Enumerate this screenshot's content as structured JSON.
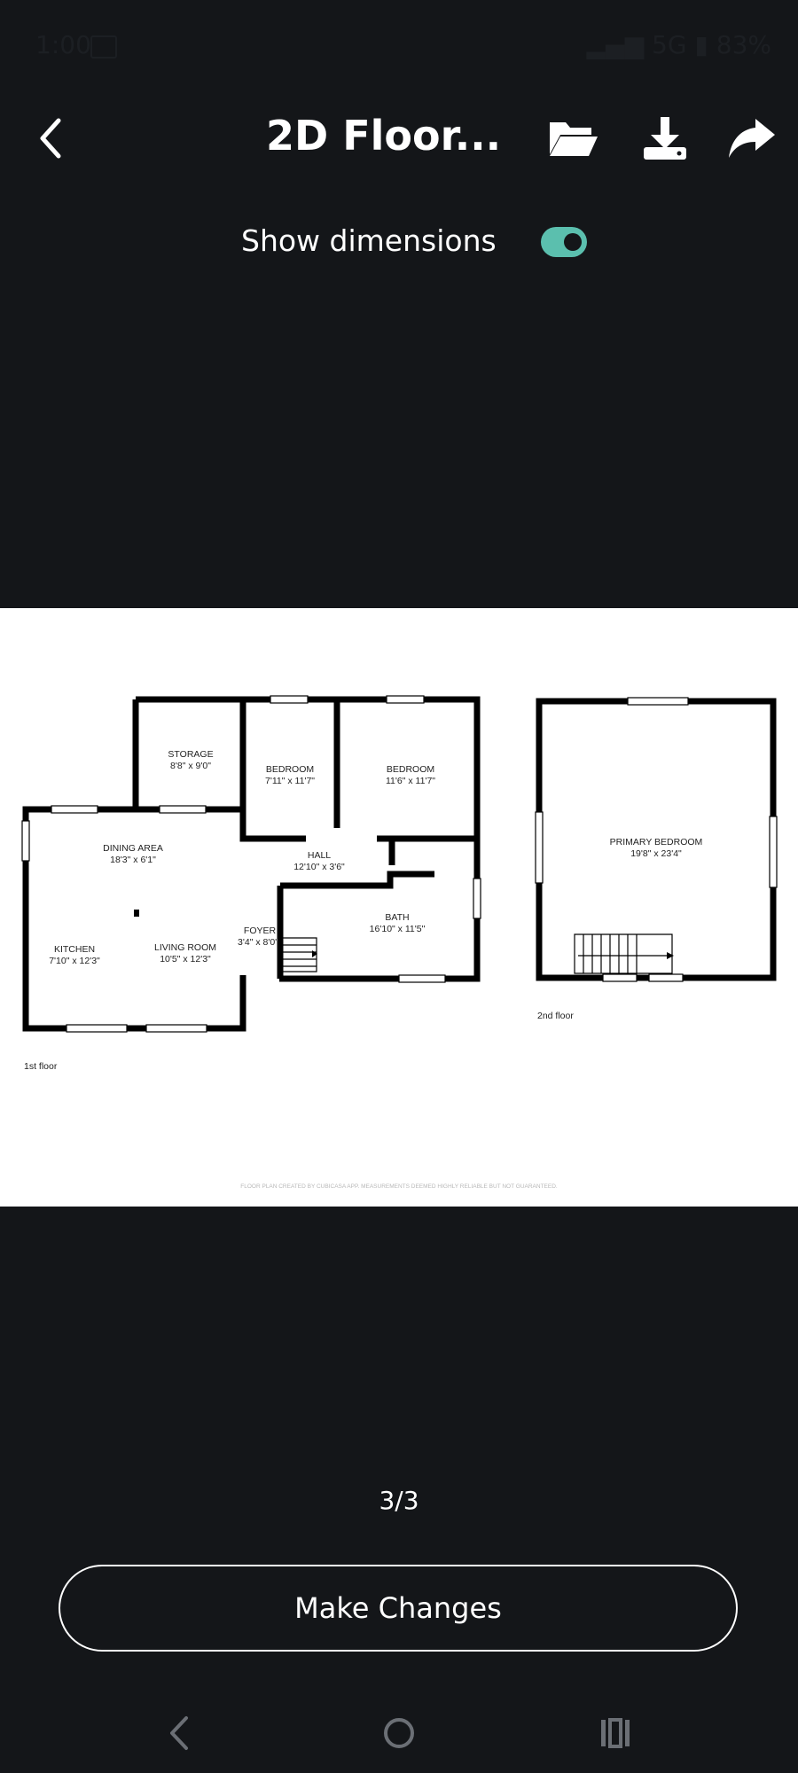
{
  "status_bar": {
    "time": "1:00",
    "network": "5G",
    "battery": "83%"
  },
  "header": {
    "title": "2D Floor...",
    "icons": [
      "back-icon",
      "folder-open-icon",
      "download-icon",
      "share-icon"
    ]
  },
  "toggle": {
    "label": "Show dimensions",
    "on": true,
    "color": "#5bbfae"
  },
  "floor_plan": {
    "first_floor_caption": "1st floor",
    "second_floor_caption": "2nd floor",
    "disclaimer": "FLOOR PLAN CREATED BY CUBICASA APP. MEASUREMENTS DEEMED HIGHLY RELIABLE BUT NOT GUARANTEED.",
    "rooms": [
      {
        "name": "STORAGE",
        "dims": "8'8\" x 9'0\""
      },
      {
        "name": "BEDROOM",
        "dims": "7'11\" x 11'7\""
      },
      {
        "name": "BEDROOM",
        "dims": "11'6\" x 11'7\""
      },
      {
        "name": "DINING AREA",
        "dims": "18'3\" x 6'1\""
      },
      {
        "name": "HALL",
        "dims": "12'10\" x 3'6\""
      },
      {
        "name": "FOYER",
        "dims": "3'4\" x 8'0\""
      },
      {
        "name": "BATH",
        "dims": "16'10\" x 11'5\""
      },
      {
        "name": "KITCHEN",
        "dims": "7'10\" x 12'3\""
      },
      {
        "name": "LIVING ROOM",
        "dims": "10'5\" x 12'3\""
      },
      {
        "name": "PRIMARY BEDROOM",
        "dims": "19'8\" x 23'4\""
      }
    ]
  },
  "pager": {
    "text": "3/3"
  },
  "primary_button": {
    "label": "Make Changes"
  },
  "nav_bar": {
    "icons": [
      "nav-back-icon",
      "nav-home-icon",
      "nav-recents-icon"
    ]
  }
}
